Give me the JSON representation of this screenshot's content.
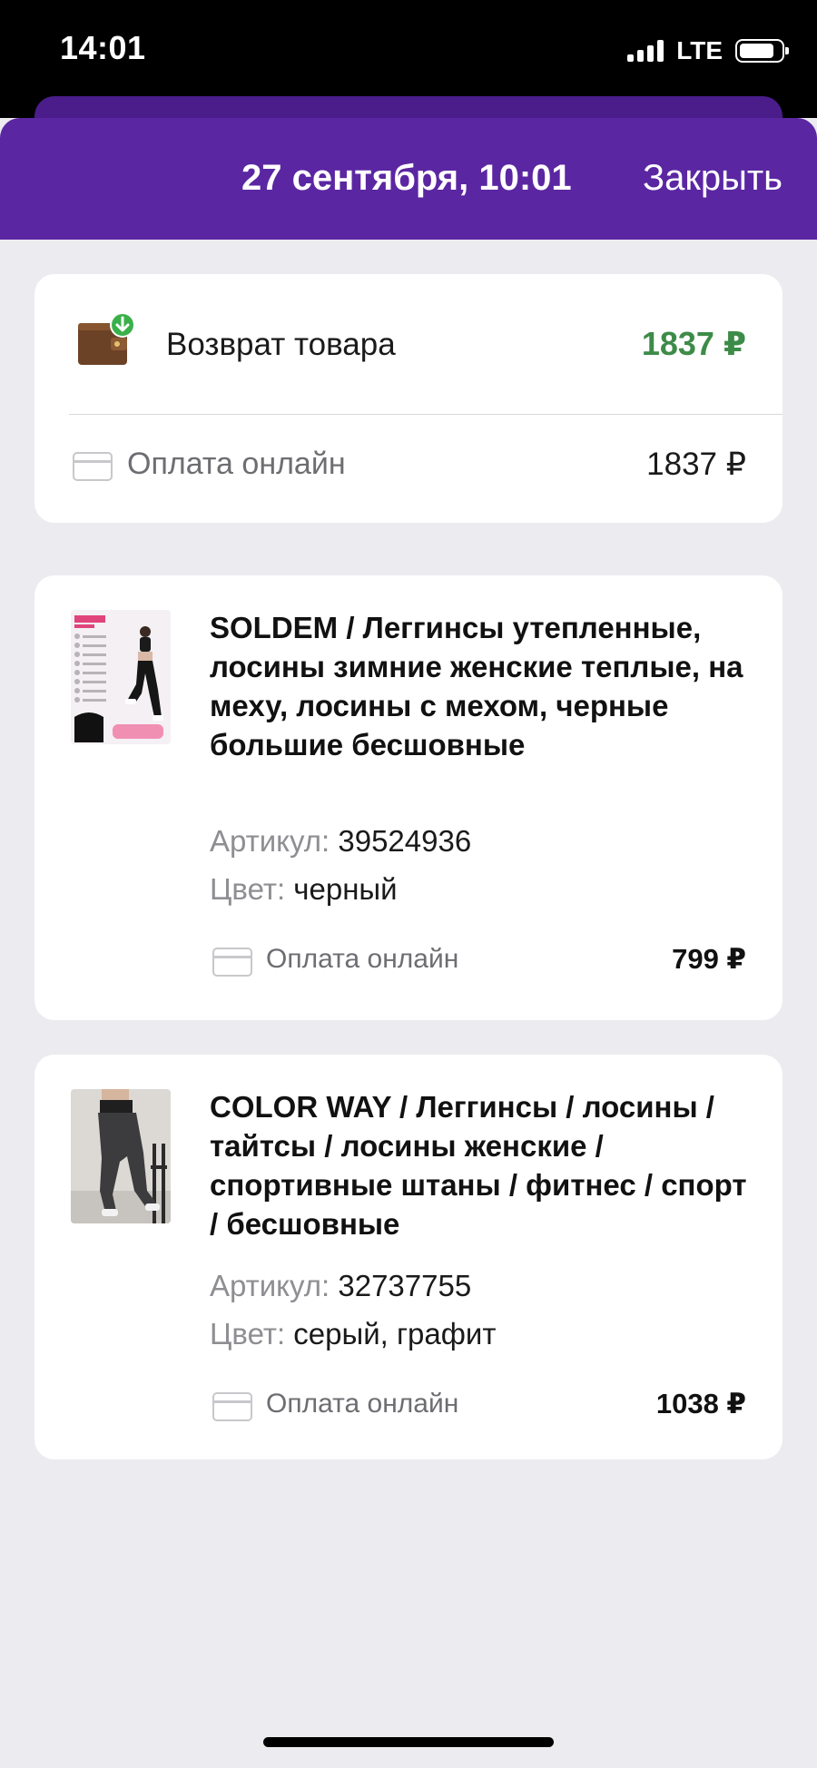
{
  "status_bar": {
    "time": "14:01",
    "network": "LTE",
    "battery_level": 0.85
  },
  "header": {
    "title": "27 сентября, 10:01",
    "close_label": "Закрыть"
  },
  "summary": {
    "icon": "wallet-return-icon",
    "label": "Возврат товара",
    "amount": "1837 ₽",
    "amount_color": "#3d8b48",
    "payment_icon": "credit-card-icon",
    "payment_label": "Оплата онлайн",
    "payment_amount": "1837 ₽"
  },
  "items": [
    {
      "thumb_icon": "product-image-leggings-black",
      "title": "SOLDEM / Леггинсы утепленные, лосины зимние женские теплые, на меху, лосины с мехом, черные большие бесшовные",
      "sku_label": "Артикул:",
      "sku": "39524936",
      "color_label": "Цвет:",
      "color": "черный",
      "payment_label": "Оплата онлайн",
      "price": "799 ₽"
    },
    {
      "thumb_icon": "product-image-leggings-grey",
      "title": "COLOR WAY / Леггинсы / лосины / тайтсы / лосины женские / спортивные штаны / фитнес / спорт / бесшовные",
      "sku_label": "Артикул:",
      "sku": "32737755",
      "color_label": "Цвет:",
      "color": "серый, графит",
      "payment_label": "Оплата онлайн",
      "price": "1038 ₽"
    }
  ],
  "colors": {
    "accent": "#5b26a2",
    "background": "#ebebf0",
    "return_green": "#3d8b48"
  }
}
